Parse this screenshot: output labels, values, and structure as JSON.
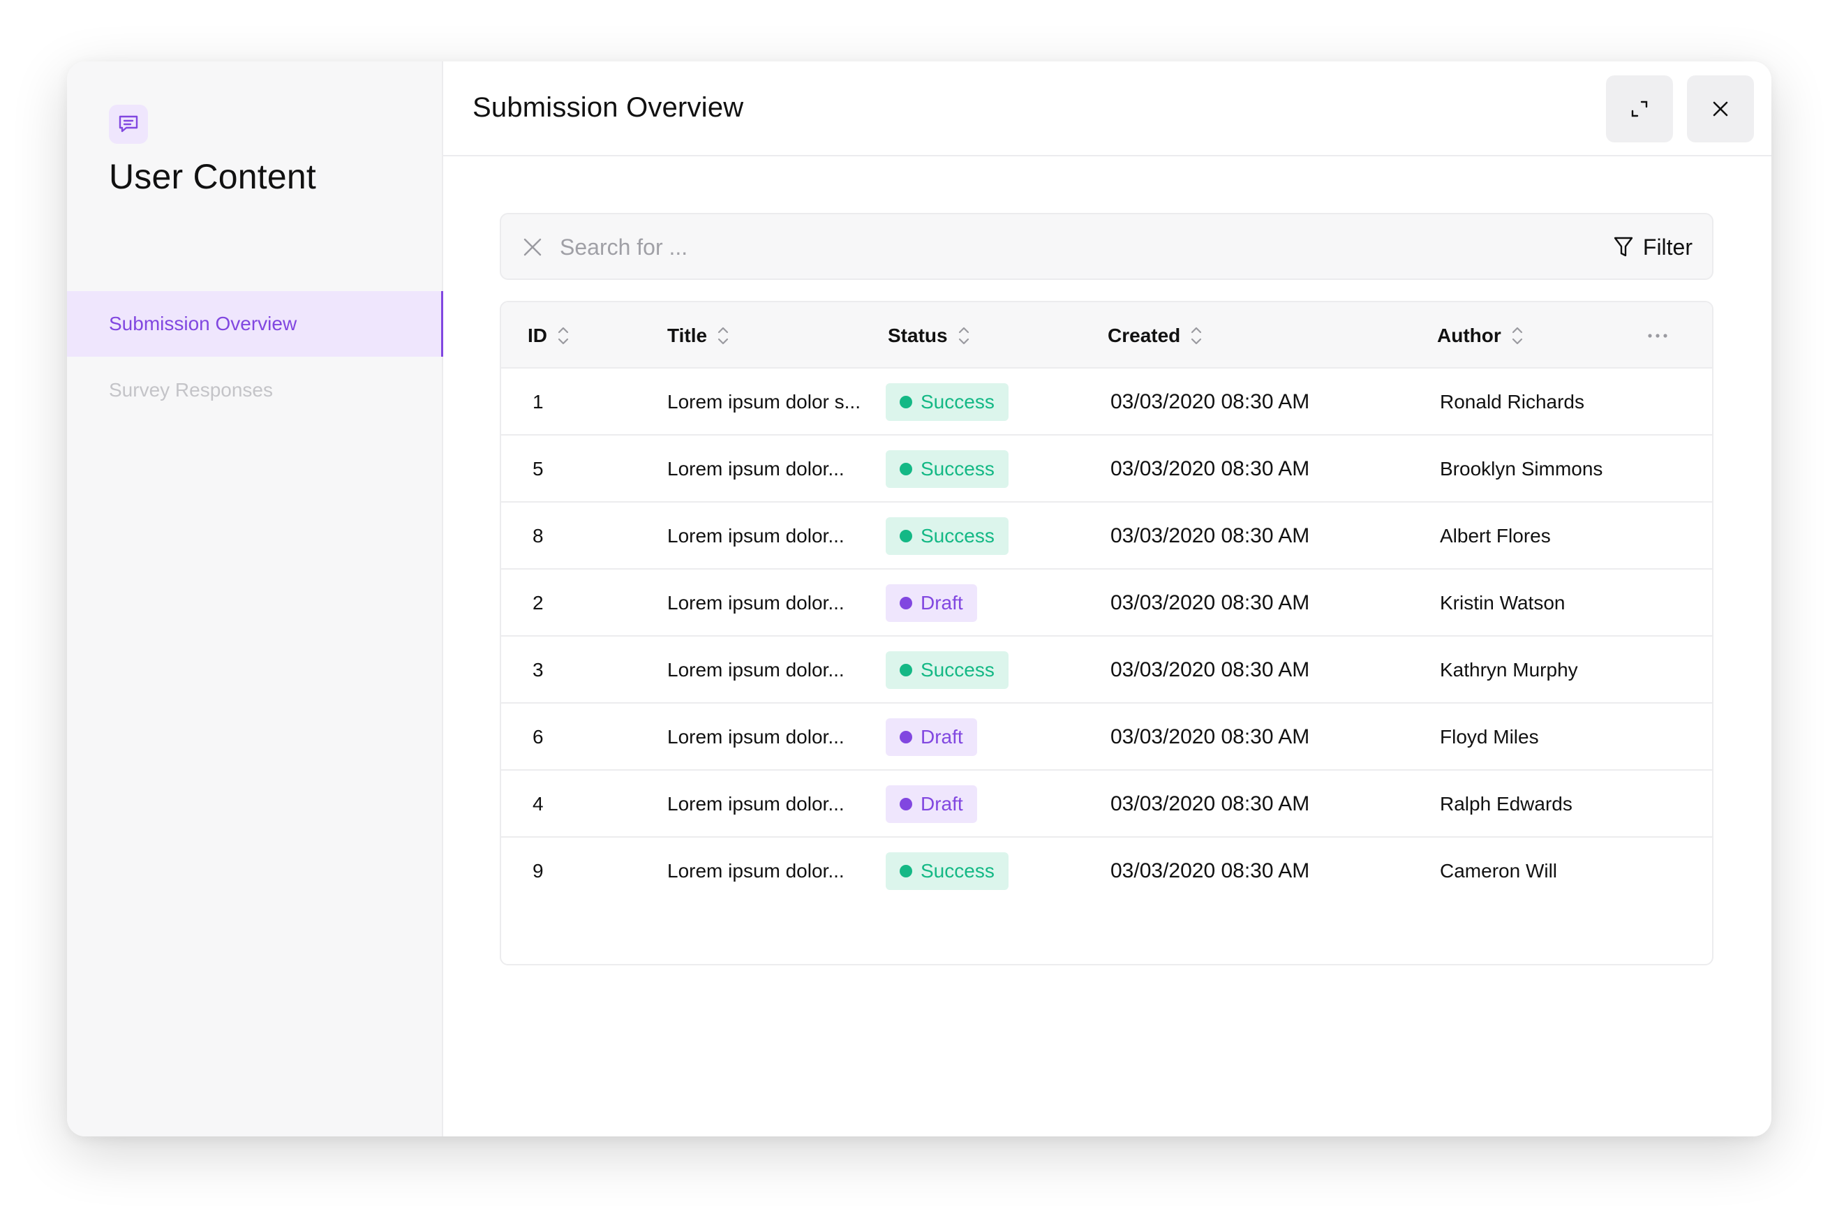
{
  "sidebar": {
    "app_title": "User Content",
    "items": [
      {
        "label": "Submission Overview",
        "active": true
      },
      {
        "label": "Survey Responses",
        "active": false
      }
    ]
  },
  "header": {
    "title": "Submission Overview"
  },
  "search": {
    "placeholder": "Search for ...",
    "value": "",
    "filter_label": "Filter"
  },
  "table": {
    "columns": {
      "id": "ID",
      "title": "Title",
      "status": "Status",
      "created": "Created",
      "author": "Author"
    },
    "rows": [
      {
        "id": "1",
        "title": "Lorem ipsum dolor s...",
        "status": "Success",
        "created": "03/03/2020 08:30 AM",
        "author": "Ronald Richards"
      },
      {
        "id": "5",
        "title": "Lorem ipsum dolor...",
        "status": "Success",
        "created": "03/03/2020 08:30 AM",
        "author": "Brooklyn Simmons"
      },
      {
        "id": "8",
        "title": "Lorem ipsum dolor...",
        "status": "Success",
        "created": "03/03/2020 08:30 AM",
        "author": "Albert Flores"
      },
      {
        "id": "2",
        "title": "Lorem ipsum dolor...",
        "status": "Draft",
        "created": "03/03/2020 08:30 AM",
        "author": "Kristin Watson"
      },
      {
        "id": "3",
        "title": "Lorem ipsum dolor...",
        "status": "Success",
        "created": "03/03/2020 08:30 AM",
        "author": "Kathryn Murphy"
      },
      {
        "id": "6",
        "title": "Lorem ipsum dolor...",
        "status": "Draft",
        "created": "03/03/2020 08:30 AM",
        "author": "Floyd Miles"
      },
      {
        "id": "4",
        "title": "Lorem ipsum dolor...",
        "status": "Draft",
        "created": "03/03/2020 08:30 AM",
        "author": "Ralph Edwards"
      },
      {
        "id": "9",
        "title": "Lorem ipsum dolor...",
        "status": "Success",
        "created": "03/03/2020 08:30 AM",
        "author": "Cameron Will"
      }
    ]
  },
  "icons": {
    "app": "chat-bubble-icon",
    "expand": "expand-icon",
    "close": "close-icon",
    "clear": "clear-search-icon",
    "filter": "funnel-icon",
    "sort": "sort-icon",
    "more": "more-horizontal-icon"
  },
  "colors": {
    "accent": "#8147e0",
    "accent_bg": "#efe6fd",
    "success": "#14b885",
    "success_bg": "#dcf5ec",
    "border": "#ececee",
    "muted_bg": "#f7f7f8"
  }
}
